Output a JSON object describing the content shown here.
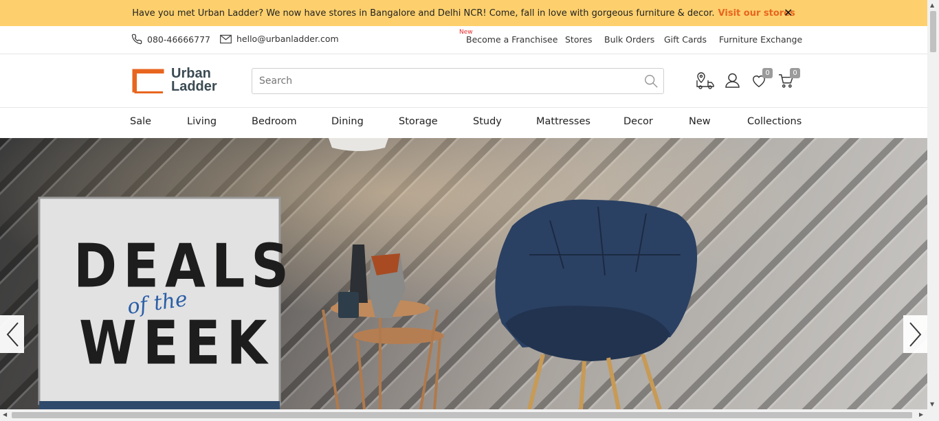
{
  "announcement": {
    "text": "Have you met Urban Ladder? We now have stores in Bangalore and Delhi NCR! Come, fall in love with gorgeous furniture & decor.",
    "link": "Visit our stores",
    "close": "✕"
  },
  "contact": {
    "phone": "080-46666777",
    "email": "hello@urbanladder.com"
  },
  "top_nav": {
    "new_tag": "New",
    "items": [
      "Become a Franchisee",
      "Stores",
      "Bulk Orders",
      "Gift Cards",
      "Furniture Exchange"
    ]
  },
  "logo": {
    "line1": "Urban",
    "line2": "Ladder"
  },
  "search": {
    "placeholder": "Search"
  },
  "header_icons": {
    "wishlist_count": "0",
    "cart_count": "0"
  },
  "categories": [
    "Sale",
    "Living",
    "Bedroom",
    "Dining",
    "Storage",
    "Study",
    "Mattresses",
    "Decor",
    "New",
    "Collections"
  ],
  "hero": {
    "line1": "DEALS",
    "script": "of the",
    "line2": "WEEK"
  },
  "colors": {
    "announcement_bg": "#fdd06d",
    "link": "#e8651f",
    "logo_orange": "#e8651f",
    "new_tag": "#e52a2a"
  }
}
